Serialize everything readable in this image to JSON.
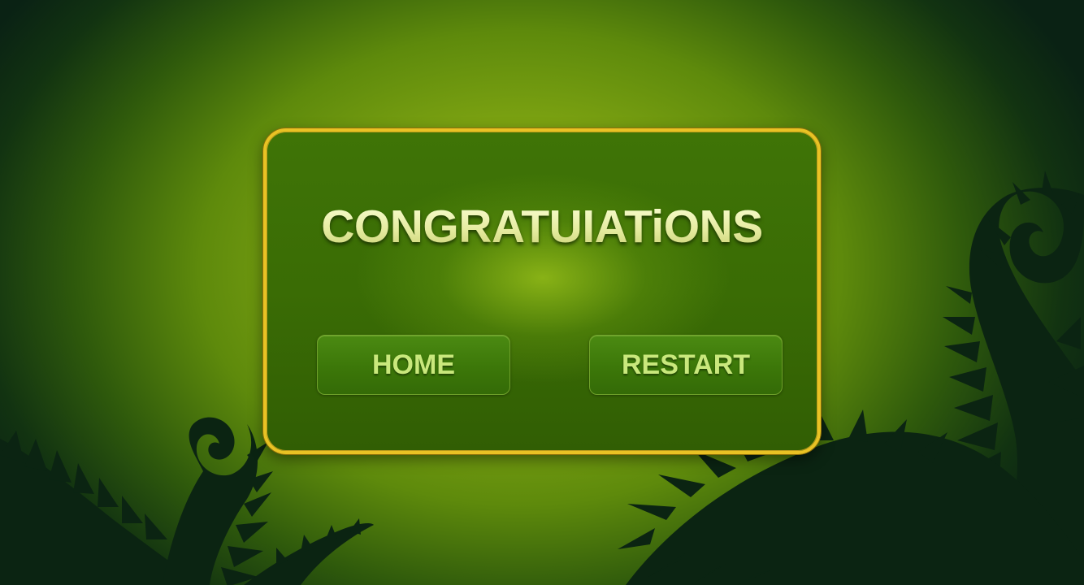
{
  "dialog": {
    "title": "CONGRATUIATiONS",
    "buttons": {
      "home_label": "HOME",
      "restart_label": "RESTART"
    }
  },
  "colors": {
    "background_center": "#8fb515",
    "background_edge": "#0a2214",
    "dialog_fill": "#3a6c05",
    "dialog_border": "#e9c224",
    "title_text": "#e8efa8",
    "button_text": "#c9e87c",
    "foliage": "#0b2412"
  },
  "icons": {
    "left_fern": "fern-silhouette",
    "right_fern": "fern-silhouette"
  }
}
